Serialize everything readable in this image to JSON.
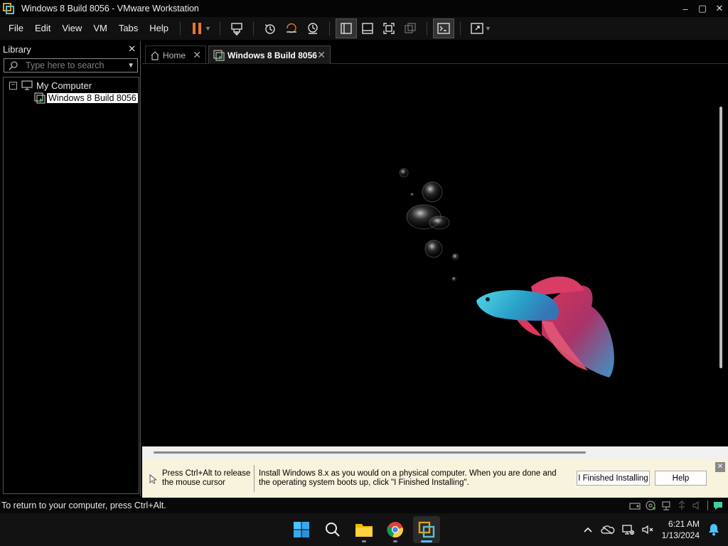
{
  "window": {
    "title": "Windows 8 Build 8056 - VMware Workstation",
    "minimize": "–",
    "maximize": "▢",
    "close": "✕"
  },
  "menu": {
    "items": [
      "File",
      "Edit",
      "View",
      "VM",
      "Tabs",
      "Help"
    ]
  },
  "toolbar": {
    "icons": [
      "pause-icon",
      "send-ctrl-alt-del-icon",
      "snapshot-icon",
      "revert-snapshot-icon",
      "snapshot-manager-icon",
      "show-library-icon",
      "thumbnail-bar-icon",
      "full-screen-icon",
      "unity-icon",
      "console-view-icon",
      "stretch-guest-icon"
    ],
    "accent_pause": "#e8762b"
  },
  "library": {
    "title": "Library",
    "close": "✕",
    "search_placeholder": "Type here to search",
    "tree": {
      "root": "My Computer",
      "expander": "−",
      "vm": "Windows 8 Build 8056"
    }
  },
  "tabs": [
    {
      "label": "Home",
      "close": "✕"
    },
    {
      "label": "Windows 8 Build 8056",
      "close": "✕"
    }
  ],
  "install_bar": {
    "release_hint": "Press Ctrl+Alt to release the mouse cursor",
    "message": "Install Windows 8.x as you would on a physical computer. When you are done and the operating system boots up, click \"I Finished Installing\".",
    "finished_button": "I Finished Installing",
    "help_button": "Help",
    "close": "✕",
    "background": "#f8f3dc"
  },
  "status": {
    "text": "To return to your computer, press Ctrl+Alt."
  },
  "taskbar": {
    "apps": [
      "start-icon",
      "search-icon",
      "file-explorer-icon",
      "chrome-icon",
      "vmware-icon"
    ],
    "time": "6:21 AM",
    "date": "1/13/2024"
  }
}
